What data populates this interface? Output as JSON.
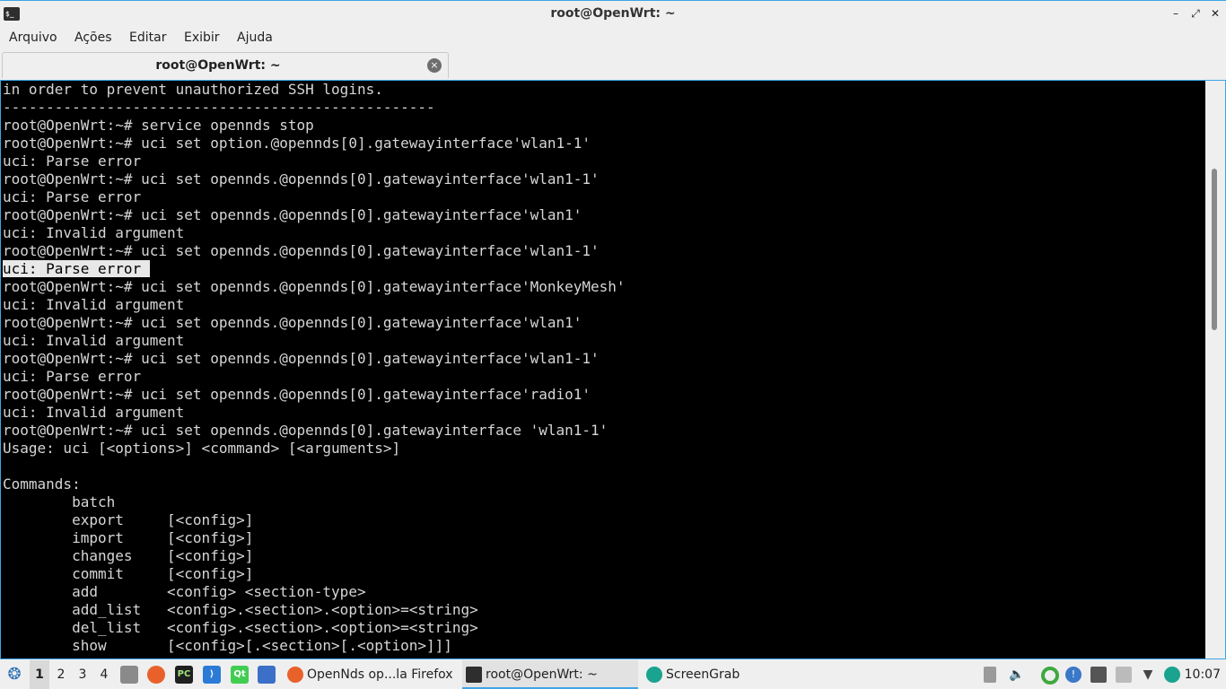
{
  "window": {
    "title": "root@OpenWrt: ~",
    "icon_text": "$_",
    "minimize": "–",
    "maximize": "⤢",
    "close": "✕"
  },
  "menu": [
    "Arquivo",
    "Ações",
    "Editar",
    "Exibir",
    "Ajuda"
  ],
  "tab": {
    "label": "root@OpenWrt: ~",
    "close": "×"
  },
  "terminal": {
    "lines": [
      "in order to prevent unauthorized SSH logins.",
      "--------------------------------------------------",
      "root@OpenWrt:~# service opennds stop",
      "root@OpenWrt:~# uci set option.@opennds[0].gatewayinterface'wlan1-1'",
      "uci: Parse error",
      "root@OpenWrt:~# uci set opennds.@opennds[0].gatewayinterface'wlan1-1'",
      "uci: Parse error",
      "root@OpenWrt:~# uci set opennds.@opennds[0].gatewayinterface'wlan1'",
      "uci: Invalid argument",
      "root@OpenWrt:~# uci set opennds.@opennds[0].gatewayinterface'wlan1-1'",
      "uci: Parse error ",
      "root@OpenWrt:~# uci set opennds.@opennds[0].gatewayinterface'MonkeyMesh'",
      "uci: Invalid argument",
      "root@OpenWrt:~# uci set opennds.@opennds[0].gatewayinterface'wlan1'",
      "uci: Invalid argument",
      "root@OpenWrt:~# uci set opennds.@opennds[0].gatewayinterface'wlan1-1'",
      "uci: Parse error",
      "root@OpenWrt:~# uci set opennds.@opennds[0].gatewayinterface'radio1'",
      "uci: Invalid argument",
      "root@OpenWrt:~# uci set opennds.@opennds[0].gatewayinterface 'wlan1-1'",
      "Usage: uci [<options>] <command> [<arguments>]",
      "",
      "Commands:",
      "        batch",
      "        export     [<config>]",
      "        import     [<config>]",
      "        changes    [<config>]",
      "        commit     [<config>]",
      "        add        <config> <section-type>",
      "        add_list   <config>.<section>.<option>=<string>",
      "        del_list   <config>.<section>.<option>=<string>",
      "        show       [<config>[.<section>[.<option>]]]"
    ],
    "selected_line": 10
  },
  "taskbar": {
    "desktops": [
      "1",
      "2",
      "3",
      "4"
    ],
    "active_desktop": "1",
    "tasks": [
      {
        "label": "OpenNds op...la Firefox",
        "icon": "firefox-icon",
        "color": "#e8612b"
      },
      {
        "label": "root@OpenWrt: ~",
        "icon": "terminal-icon",
        "color": "#2e2e2e"
      },
      {
        "label": "ScreenGrab",
        "icon": "screengrab-icon",
        "color": "#1aa38f"
      }
    ],
    "clock": "10:07"
  },
  "colors": {
    "accent": "#3da6e6",
    "terminal_bg": "#000000",
    "terminal_fg": "#d6d6d6"
  }
}
